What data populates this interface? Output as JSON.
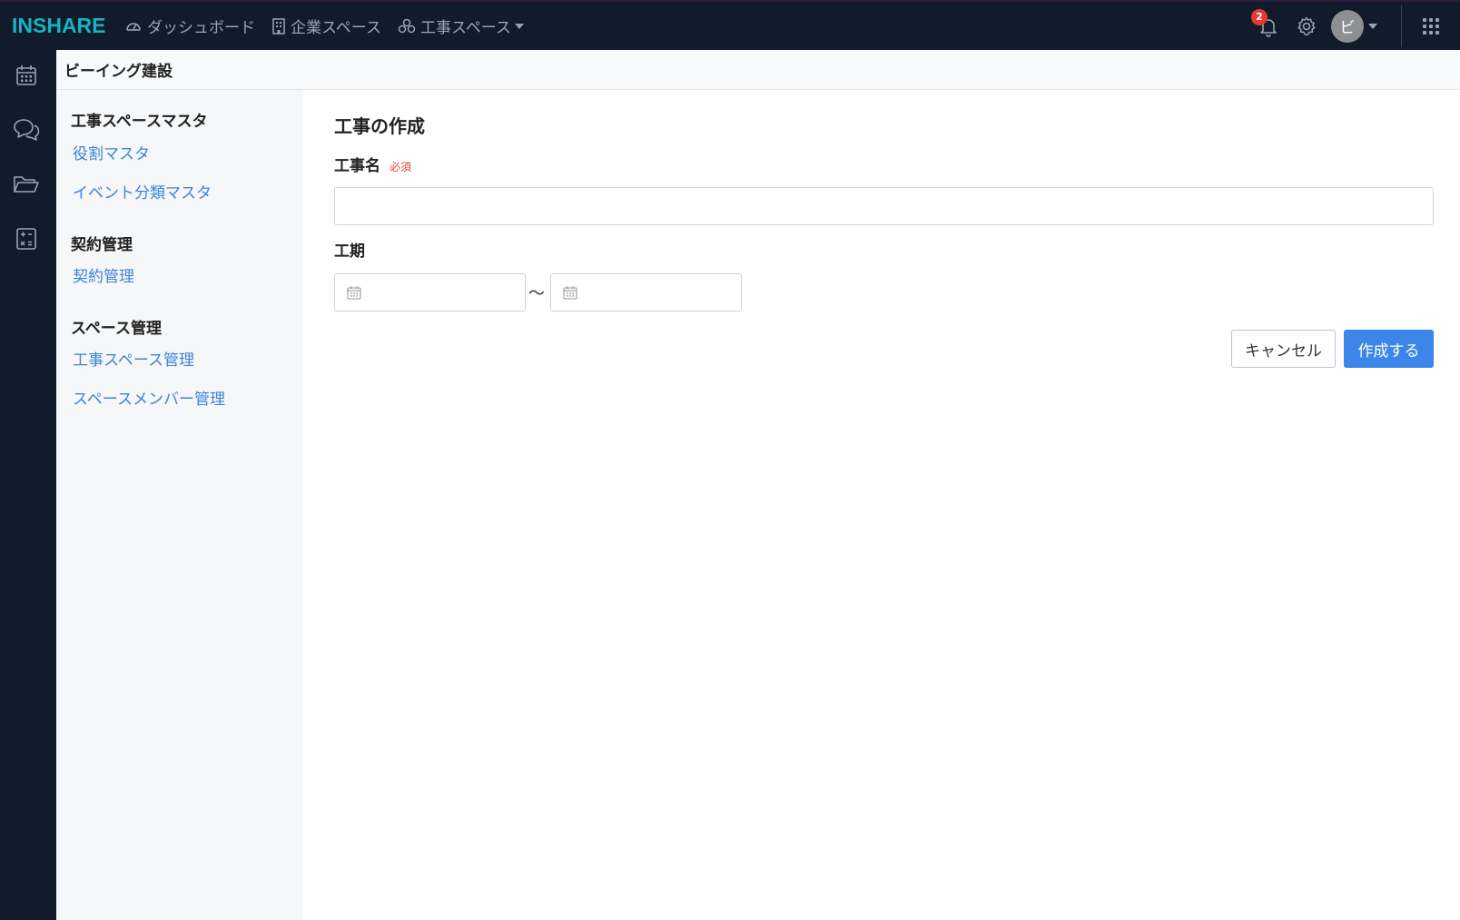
{
  "app": {
    "logo_text": "INSHARE",
    "brand_color": "#16b3c4"
  },
  "topnav": {
    "items": [
      {
        "label": "ダッシュボード",
        "icon": "dashboard-icon"
      },
      {
        "label": "企業スペース",
        "icon": "building-icon"
      },
      {
        "label": "工事スペース",
        "icon": "cubes-icon",
        "has_dropdown": true
      }
    ],
    "notification_count": "2",
    "avatar_initial": "ビ"
  },
  "rail": {
    "icons": [
      "calendar-icon",
      "chat-icon",
      "folder-icon",
      "calculator-icon"
    ]
  },
  "breadcrumb": {
    "company": "ビーイング建設"
  },
  "subnav": {
    "sections": [
      {
        "title": "工事スペースマスタ",
        "links": [
          "役割マスタ",
          "イベント分類マスタ"
        ]
      },
      {
        "title": "契約管理",
        "links": [
          "契約管理"
        ]
      },
      {
        "title": "スペース管理",
        "links": [
          "工事スペース管理",
          "スペースメンバー管理"
        ]
      }
    ]
  },
  "form": {
    "title": "工事の作成",
    "name_label": "工事名",
    "required_label": "必須",
    "name_value": "",
    "period_label": "工期",
    "period_separator": "〜",
    "start_date": "",
    "end_date": "",
    "cancel_label": "キャンセル",
    "submit_label": "作成する",
    "accent_color": "#3b86e8"
  }
}
